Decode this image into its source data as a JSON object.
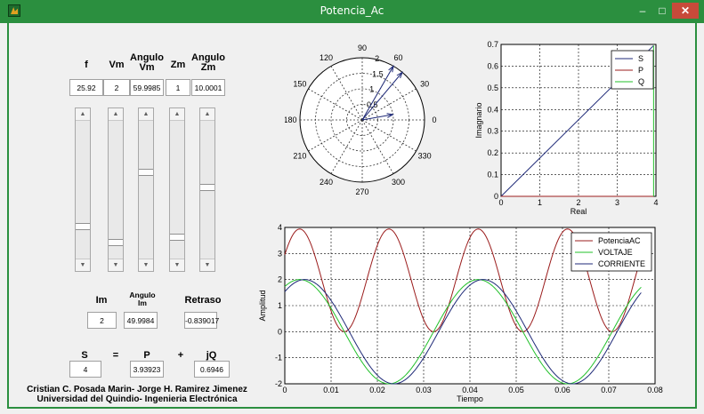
{
  "window": {
    "title": "Potencia_Ac",
    "minimize": "–",
    "maximize": "□",
    "close": "✕"
  },
  "controls": [
    {
      "label": "f",
      "value": "25.92",
      "level": 0.78
    },
    {
      "label": "Vm",
      "value": "2",
      "level": 0.9
    },
    {
      "label": "Angulo Vm",
      "value": "59.9985",
      "level": 0.37
    },
    {
      "label": "Zm",
      "value": "1",
      "level": 0.86
    },
    {
      "label": "Angulo Zm",
      "value": "10.0001",
      "level": 0.48
    }
  ],
  "results": [
    {
      "label": "Im",
      "value": "2"
    },
    {
      "label": "Angulo Im",
      "value": "49.9984"
    },
    {
      "label": "Retraso",
      "value": "-0.839017"
    }
  ],
  "power": {
    "s_label": "S",
    "eq": "=",
    "p_label": "P",
    "plus": "+",
    "q_label": "jQ",
    "s_value": "4",
    "p_value": "3.93923",
    "q_value": "0.6946"
  },
  "authors": {
    "line1": "Cristian C. Posada Marin- Jorge H. Ramirez Jimenez",
    "line2": "Universidad del Quindio- Ingenieria Electrónica"
  },
  "chart_data": [
    {
      "type": "polar",
      "angle_ticks": [
        "0",
        "30",
        "60",
        "90",
        "120",
        "150",
        "180",
        "210",
        "240",
        "270",
        "300",
        "330"
      ],
      "radial_ticks": [
        "0.5",
        "1",
        "1.5",
        "2"
      ],
      "rmax": 2,
      "vectors": [
        {
          "angle": 60,
          "r": 2
        },
        {
          "angle": 50,
          "r": 2
        },
        {
          "angle": 10,
          "r": 1
        }
      ],
      "color": "#1f2a78"
    },
    {
      "type": "line",
      "xlabel": "Real",
      "ylabel": "Imagnario",
      "xlim": [
        0,
        4
      ],
      "ylim": [
        0,
        0.7
      ],
      "xticks": [
        "0",
        "1",
        "2",
        "3",
        "4"
      ],
      "yticks": [
        "0",
        "0.1",
        "0.2",
        "0.3",
        "0.4",
        "0.5",
        "0.6",
        "0.7"
      ],
      "grid": true,
      "legend_position": "top-right",
      "series": [
        {
          "name": "S",
          "color": "#1f2a78",
          "points": [
            [
              0,
              0
            ],
            [
              3.93923,
              0.6946
            ]
          ]
        },
        {
          "name": "P",
          "color": "#9b1c1c",
          "points": [
            [
              0,
              0
            ],
            [
              3.93923,
              0
            ]
          ]
        },
        {
          "name": "Q",
          "color": "#22c02a",
          "points": [
            [
              3.93923,
              0
            ],
            [
              3.93923,
              0.6946
            ]
          ]
        }
      ]
    },
    {
      "type": "line",
      "xlabel": "Tiempo",
      "ylabel": "Amplitud",
      "xlim": [
        0,
        0.08
      ],
      "ylim": [
        -2,
        4
      ],
      "xticks": [
        "0",
        "0.01",
        "0.02",
        "0.03",
        "0.04",
        "0.05",
        "0.06",
        "0.07",
        "0.08"
      ],
      "yticks": [
        "-2",
        "-1",
        "0",
        "1",
        "2",
        "3",
        "4"
      ],
      "grid": true,
      "legend_position": "top-right",
      "t_end": 0.077,
      "freq": 25.92,
      "series": [
        {
          "name": "PotenciaAC",
          "color": "#9b1c1c",
          "amplitude": 2,
          "phase_deg": 59.9985,
          "kind": "power",
          "offset": 1.96961
        },
        {
          "name": "VOLTAJE",
          "color": "#22c02a",
          "amplitude": 2,
          "phase_deg": 59.9985,
          "kind": "sin"
        },
        {
          "name": "CORRIENTE",
          "color": "#1f2a78",
          "amplitude": 2,
          "phase_deg": 49.9984,
          "kind": "sin"
        }
      ]
    }
  ]
}
